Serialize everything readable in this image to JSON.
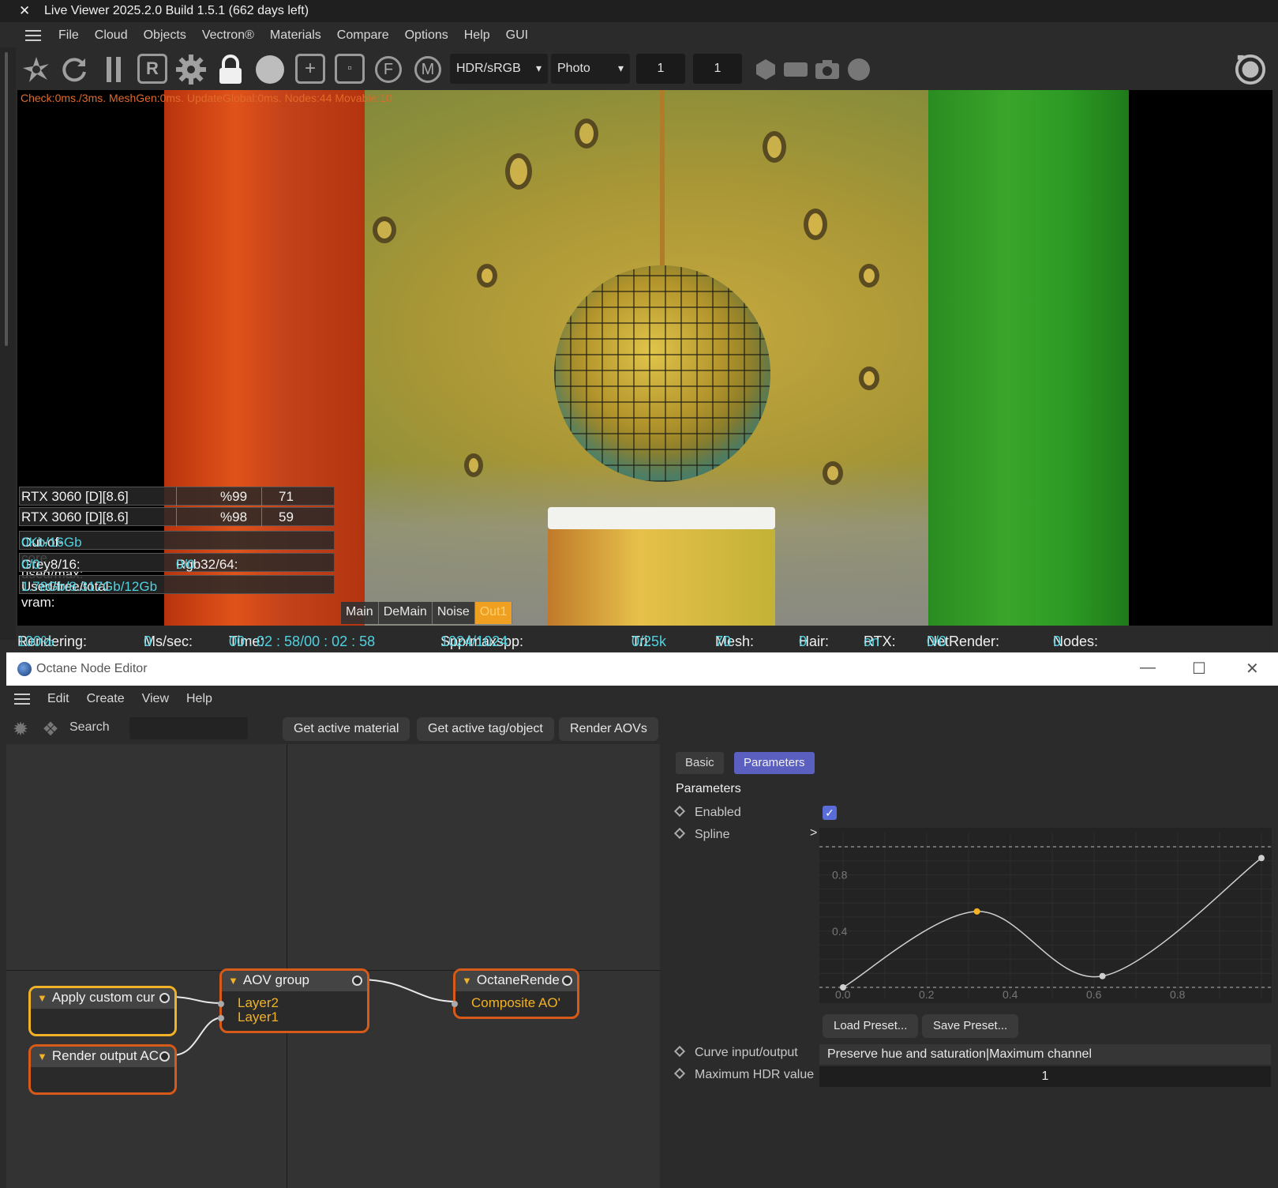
{
  "live_viewer": {
    "close_glyph": "✕",
    "title": "Live Viewer 2025.2.0 Build 1.5.1 (662 days left)",
    "menu": [
      "File",
      "Cloud",
      "Objects",
      "Vectron®",
      "Materials",
      "Compare",
      "Options",
      "Help",
      "GUI"
    ],
    "toolbar": {
      "icon_names": [
        "send-icon",
        "refresh-icon",
        "pause-icon",
        "region-icon",
        "settings-gear-icon",
        "lock-icon",
        "clay-sphere-icon",
        "add-region-icon",
        "film-region-icon",
        "focus-picker-icon",
        "material-picker-icon",
        "hexagon-icon",
        "rectangle-icon",
        "camera-icon",
        "circle-icon",
        "record-icon"
      ],
      "region_label": "R",
      "focus_label": "F",
      "material_label": "M",
      "color_space": "HDR/sRGB",
      "imager_mode": "Photo",
      "num1": "1",
      "num2": "1"
    },
    "check_text": "Check:0ms./3ms. MeshGen:0ms. UpdateGlobal:0ms. Nodes:44 Movable:10",
    "gpus": [
      {
        "name": "RTX 3060 [D][8.6]",
        "usage": "%99",
        "temp": "71"
      },
      {
        "name": "RTX 3060 [D][8.6]",
        "usage": "%98",
        "temp": "59"
      }
    ],
    "out_of_core_label": "Out-of-core used/max:",
    "out_of_core_value": "0Kb/16Gb",
    "grey_label": "Grey8/16: ",
    "grey_value": "0/0",
    "rgb_label": "Rgb32/64: ",
    "rgb_value": "0/0",
    "vram_label": "Used/free/total vram: ",
    "vram_value": "1.78Gb/8.317Gb/12Gb",
    "aov_tabs": [
      "Main",
      "DeMain",
      "Noise",
      "Out1"
    ],
    "status": {
      "rendering_label": "Rendering: ",
      "rendering_value": "100%",
      "ms_label": "Ms/sec: ",
      "ms_value": "0",
      "time_label": "Time: ",
      "time_value": "00 : 02 : 58/00 : 02 : 58",
      "spp_label": "Spp/maxspp: ",
      "spp_value": "1024/1024",
      "tri_label": "Tri: ",
      "tri_value": "0/25k",
      "mesh_label": "Mesh: ",
      "mesh_value": "70",
      "hair_label": "Hair: ",
      "hair_value": "0",
      "rtx_label": "RTX:",
      "rtx_value": "on",
      "net_label": "NetRender: ",
      "net_value": "0/0",
      "nodes_label": "Nodes: ",
      "nodes_value": "0"
    },
    "colors": {
      "accent_cyan": "#4fd2e0",
      "active_tab": "#f0a020"
    }
  },
  "node_editor": {
    "title": "Octane Node Editor",
    "window_controls": {
      "minimize": "—",
      "maximize": "☐",
      "close": "✕"
    },
    "menu": [
      "Edit",
      "Create",
      "View",
      "Help"
    ],
    "search_label": "Search",
    "buttons": {
      "get_active_material": "Get active material",
      "get_active_tag": "Get active tag/object",
      "render_aovs": "Render AOVs"
    },
    "nodes": {
      "apply_custom": {
        "title": "Apply custom cur"
      },
      "render_output": {
        "title": "Render output AC"
      },
      "aov_group": {
        "title": "AOV group",
        "pins": [
          "Layer2",
          "Layer1"
        ]
      },
      "octane_render": {
        "title": "OctaneRende",
        "pins": [
          "Composite AO'"
        ]
      }
    },
    "params": {
      "tabs": {
        "basic": "Basic",
        "parameters": "Parameters"
      },
      "heading": "Parameters",
      "enabled_label": "Enabled",
      "enabled_value": true,
      "checkmark": "✓",
      "spline_label": "Spline",
      "spline_chevron": ">",
      "spline": {
        "y_ticks": [
          "0.8",
          "0.4"
        ],
        "x_ticks": [
          "0.0",
          "0.2",
          "0.4",
          "0.6",
          "0.8"
        ],
        "control_points": [
          [
            0.0,
            0.0
          ],
          [
            0.32,
            0.54
          ],
          [
            0.62,
            0.08
          ],
          [
            1.0,
            0.92
          ]
        ]
      },
      "load_preset": "Load Preset...",
      "save_preset": "Save Preset...",
      "curve_io_label": "Curve input/output",
      "curve_io_value": "Preserve hue and saturation|Maximum channel",
      "max_hdr_label": "Maximum HDR value",
      "max_hdr_value": "1"
    }
  }
}
